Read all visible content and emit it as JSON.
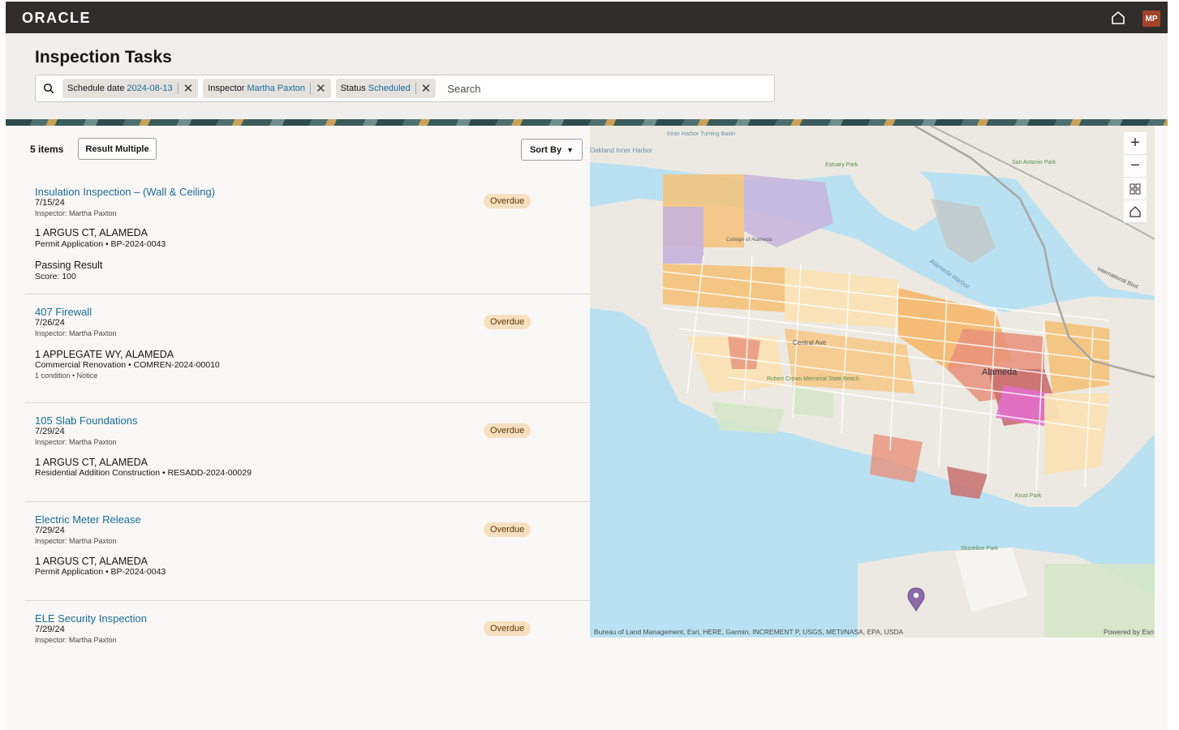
{
  "app": {
    "logo": "ORACLE",
    "avatar_initials": "MP"
  },
  "page": {
    "title": "Inspection Tasks"
  },
  "search": {
    "placeholder": "Search",
    "filters": [
      {
        "label": "Schedule date",
        "value": "2024-08-13"
      },
      {
        "label": "Inspector",
        "value": "Martha Paxton"
      },
      {
        "label": "Status",
        "value": "Scheduled"
      }
    ]
  },
  "list": {
    "count_label": "5 items",
    "result_multiple_label": "Result Multiple",
    "sort_label": "Sort By",
    "items": [
      {
        "name": "Insulation Inspection – (Wall & Ceiling)",
        "date": "7/15/24",
        "inspector": "Inspector: Martha Paxton",
        "address": "1 ARGUS CT, ALAMEDA",
        "record": "Permit Application • BP-2024-0043",
        "result": "Passing Result",
        "score": "Score: 100",
        "status": "Overdue"
      },
      {
        "name": "407 Firewall",
        "date": "7/26/24",
        "inspector": "Inspector: Martha Paxton",
        "address": "1 APPLEGATE WY, ALAMEDA",
        "record": "Commercial Renovation • COMREN-2024-00010",
        "condition": "1 condition • Notice",
        "status": "Overdue"
      },
      {
        "name": "105 Slab Foundations",
        "date": "7/29/24",
        "inspector": "Inspector: Martha Paxton",
        "address": "1 ARGUS CT, ALAMEDA",
        "record": "Residential Addition Construction • RESADD-2024-00029",
        "status": "Overdue"
      },
      {
        "name": "Electric Meter Release",
        "date": "7/29/24",
        "inspector": "Inspector: Martha Paxton",
        "address": "1 ARGUS CT, ALAMEDA",
        "record": "Permit Application • BP-2024-0043",
        "status": "Overdue"
      },
      {
        "name": "ELE Security Inspection",
        "date": "7/29/24",
        "inspector": "Inspector: Martha Paxton",
        "status": "Overdue"
      }
    ]
  },
  "map": {
    "attribution": "Bureau of Land Management, Esri, HERE, Garmin, INCREMENT P, USGS, METI/NASA, EPA, USDA",
    "powered_by": "Powered by Esri",
    "labels": {
      "alameda": "Alameda",
      "alameda_harbor": "Alameda Harbor",
      "estuary_park": "Estuary Park",
      "central_ave": "Central Ave",
      "robert_crown": "Robert Crown Memorial State Beach",
      "shoreline_park": "Shoreline Park",
      "inner_harbor": "Inner Harbor Turning Basin",
      "oakland": "Oakland Inner Harbor",
      "san_antonio_park": "San Antonio Park",
      "international_blvd": "International Blvd",
      "krusi_park": "Krusi Park",
      "college": "College of Alameda"
    },
    "controls": {
      "zoom_in": "+",
      "zoom_out": "−"
    }
  }
}
